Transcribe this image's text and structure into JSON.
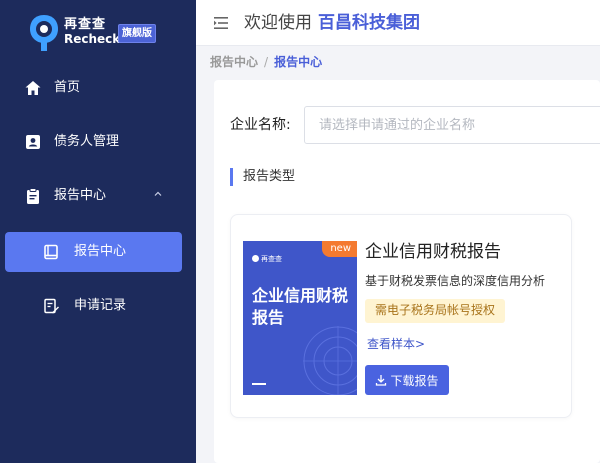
{
  "brand": {
    "name_cn": "再查查",
    "name_en": "Recheck",
    "edition": "旗舰版"
  },
  "sidebar": {
    "items": [
      {
        "label": "首页",
        "icon": "home-icon"
      },
      {
        "label": "债务人管理",
        "icon": "contact-card-icon"
      },
      {
        "label": "报告中心",
        "icon": "clipboard-icon",
        "expanded": true
      },
      {
        "label": "报告中心",
        "icon": "book-icon",
        "active": true
      },
      {
        "label": "申请记录",
        "icon": "edit-document-icon"
      }
    ]
  },
  "header": {
    "welcome": "欢迎使用",
    "company": "百昌科技集团"
  },
  "breadcrumb": {
    "items": [
      "报告中心",
      "报告中心"
    ],
    "separator": "/"
  },
  "form": {
    "company_label": "企业名称:",
    "company_placeholder": "请选择申请通过的企业名称",
    "company_value": ""
  },
  "section": {
    "title": "报告类型"
  },
  "report_card": {
    "cover_logo": "再查查",
    "cover_title": "企业信用财税报告",
    "new_tag": "new",
    "title": "企业信用财税报告",
    "description": "基于财税发票信息的深度信用分析",
    "requirement": "需电子税务局帐号授权",
    "sample_link": "查看样本>",
    "download_label": "下载报告"
  },
  "colors": {
    "sidebar_bg": "#1d2b5c",
    "accent": "#4a5fd8",
    "active_item": "#5a78f0",
    "new_tag": "#f47a30",
    "badge_bg": "#fff4d2"
  }
}
